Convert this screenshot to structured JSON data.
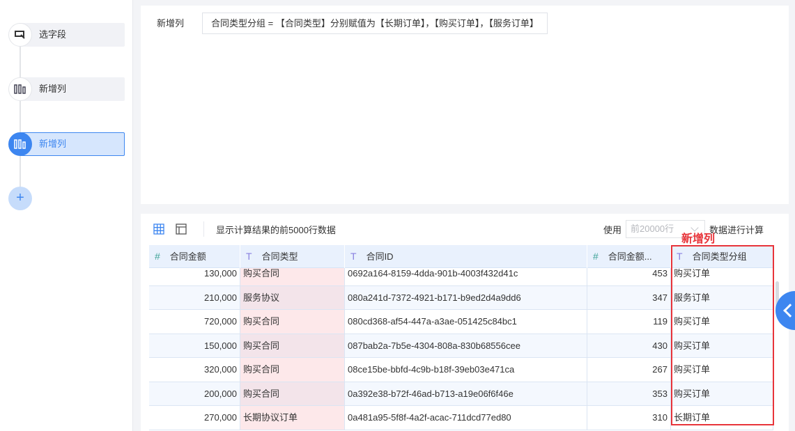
{
  "steps": [
    {
      "label": "选字段",
      "icon": "select-field-icon"
    },
    {
      "label": "新增列",
      "icon": "add-column-icon"
    },
    {
      "label": "新增列",
      "icon": "add-column-icon",
      "active": true
    }
  ],
  "top": {
    "label": "新增列",
    "formula": "合同类型分组 = 【合同类型】分别赋值为【长期订单】，【购买订单】，【服务订单】"
  },
  "toolbar": {
    "info": "显示计算结果的前5000行数据",
    "use": "使用",
    "rows_select": "前20000行",
    "suffix": "数据进行计算"
  },
  "annotation": "新增列",
  "columns": [
    {
      "type": "#",
      "name": "合同金额"
    },
    {
      "type": "T",
      "name": "合同类型"
    },
    {
      "type": "T",
      "name": "合同ID"
    },
    {
      "type": "#",
      "name": "合同金额..."
    },
    {
      "type": "T",
      "name": "合同类型分组"
    }
  ],
  "rows": [
    [
      "130,000",
      "购买合同",
      "0692a164-8159-4dda-901b-4003f432d41c",
      "453",
      "购买订单"
    ],
    [
      "210,000",
      "服务协议",
      "080a241d-7372-4921-b171-b9ed2d4a9dd6",
      "347",
      "服务订单"
    ],
    [
      "720,000",
      "购买合同",
      "080cd368-af54-447a-a3ae-051425c84bc1",
      "119",
      "购买订单"
    ],
    [
      "150,000",
      "购买合同",
      "087bab2a-7b5e-4304-808a-830b68556cee",
      "430",
      "购买订单"
    ],
    [
      "320,000",
      "购买合同",
      "08ce15be-bbfd-4c9b-b18f-39eb03e471ca",
      "267",
      "购买订单"
    ],
    [
      "200,000",
      "购买合同",
      "0a392e38-b72f-46ad-b713-a19e06f6f46e",
      "353",
      "购买订单"
    ],
    [
      "270,000",
      "长期协议订单",
      "0a481a95-5f8f-4a2f-acac-711dcd77ed80",
      "310",
      "长期订单"
    ]
  ]
}
